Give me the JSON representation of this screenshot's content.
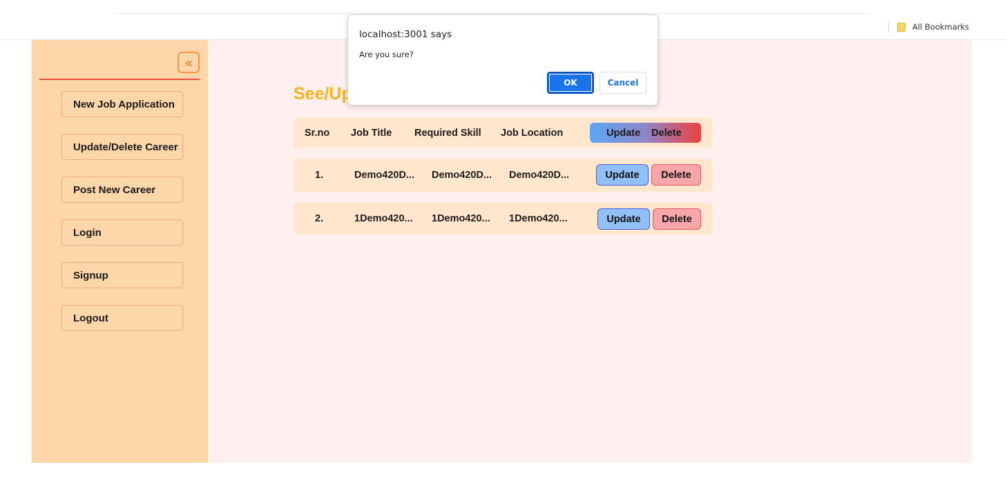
{
  "browser": {
    "bookmarks_label": "All Bookmarks"
  },
  "sidebar": {
    "collapse_icon": "«",
    "items": [
      {
        "label": "New Job Application"
      },
      {
        "label": "Update/Delete Career"
      },
      {
        "label": "Post New Career"
      },
      {
        "label": "Login"
      },
      {
        "label": "Signup"
      },
      {
        "label": "Logout"
      }
    ]
  },
  "main": {
    "title": "See/Up",
    "table": {
      "headers": {
        "sr": "Sr.no",
        "title": "Job Title",
        "skill": "Required Skill",
        "location": "Job Location",
        "update": "Update",
        "delete": "Delete"
      },
      "rows": [
        {
          "sr": "1.",
          "title": "Demo420D...",
          "skill": "Demo420D...",
          "location": "Demo420D...",
          "update": "Update",
          "delete": "Delete"
        },
        {
          "sr": "2.",
          "title": "1Demo420...",
          "skill": "1Demo420...",
          "location": "1Demo420...",
          "update": "Update",
          "delete": "Delete"
        }
      ]
    }
  },
  "dialog": {
    "title": "localhost:3001 says",
    "message": "Are you sure?",
    "ok_label": "OK",
    "cancel_label": "Cancel"
  },
  "colors": {
    "sidebar_bg": "#fdd6a9",
    "main_bg": "#fff0ef",
    "title": "#f5b41a",
    "update_btn": "#91c0f9",
    "delete_btn": "#f7a7a9",
    "dialog_ok": "#1a73e8"
  }
}
